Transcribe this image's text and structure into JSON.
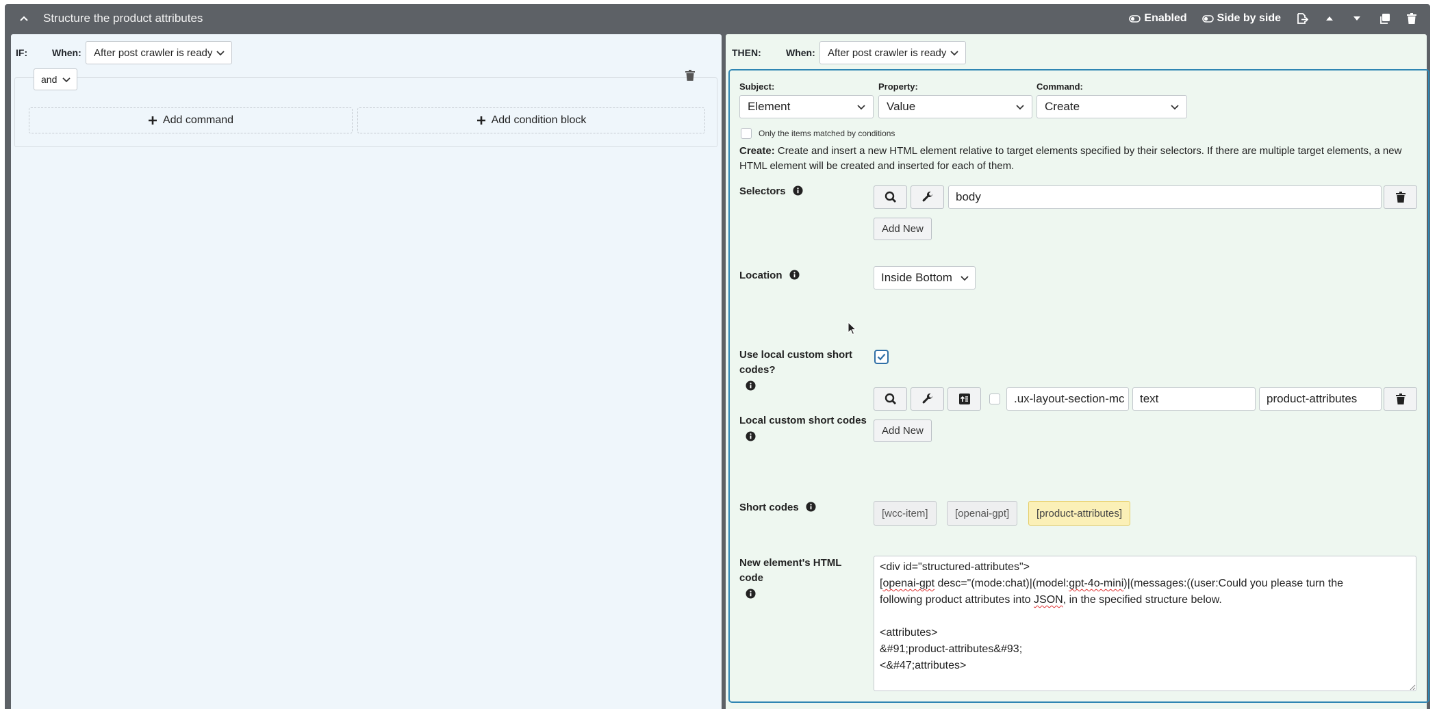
{
  "header": {
    "title": "Structure the product attributes",
    "enabled_label": "Enabled",
    "side_by_side_label": "Side by side"
  },
  "if_panel": {
    "label": "IF:",
    "when_label": "When:",
    "when_value": "After post crawler is ready",
    "logic_value": "and",
    "add_command_label": "Add command",
    "add_condition_block_label": "Add condition block"
  },
  "then_panel": {
    "label": "THEN:",
    "when_label": "When:",
    "when_value": "After post crawler is ready",
    "subject_label": "Subject:",
    "subject_value": "Element",
    "property_label": "Property:",
    "property_value": "Value",
    "command_label": "Command:",
    "command_value": "Create",
    "only_matched_label": "Only the items matched by conditions",
    "description_bold": "Create:",
    "description_text": " Create and insert a new HTML element relative to target elements specified by their selectors. If there are multiple target elements, a new HTML element will be created and inserted for each of them.",
    "selectors_label": "Selectors",
    "selector_value": "body",
    "add_new_label": "Add New",
    "location_label": "Location",
    "location_value": "Inside Bottom",
    "use_local_label": "Use local custom short codes?",
    "local_codes_label": "Local custom short codes",
    "local_selector_value": ".ux-layout-section-mc",
    "local_attr_value": "text",
    "local_name_value": "product-attributes",
    "short_codes_label": "Short codes",
    "short_codes": [
      "[wcc-item]",
      "[openai-gpt]",
      "[product-attributes]"
    ],
    "html_code_label": "New element's HTML code",
    "html_code": {
      "line1": "<div id=\"structured-attributes\">",
      "line2_a": "openai-gpt",
      "line2_b": " desc=\"(mode:chat)|(model:",
      "line2_c": "gpt-4o-mini",
      "line2_d": ")|(messages:((user:Could you please turn the",
      "line3_a": "following product attributes into ",
      "line3_b": "JSON",
      "line3_c": ", in the specified structure below.",
      "line4": "",
      "line5": "<attributes>",
      "line6": "&#91;product-attributes&#93;",
      "line7": "<&#47;attributes>"
    }
  },
  "colors": {
    "header_bg": "#5d6166",
    "if_bg": "#eff6fb",
    "then_bg": "#eef7f0",
    "card_border": "#2f86b3",
    "active_shortcode": "#fbf0b7"
  }
}
